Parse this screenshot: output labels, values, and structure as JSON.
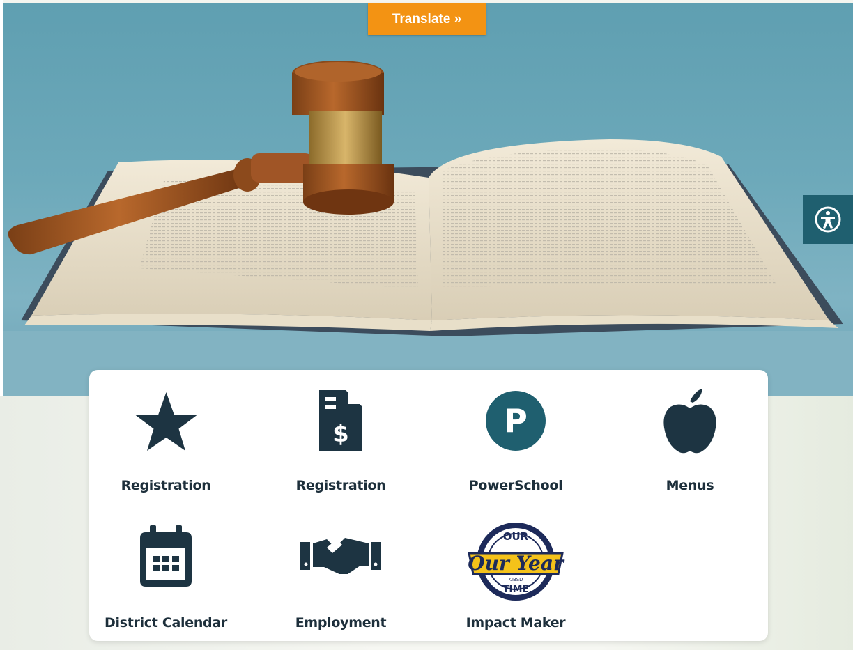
{
  "translate": {
    "label": "Translate »"
  },
  "accessibility": {
    "icon": "accessibility-icon"
  },
  "colors": {
    "navy": "#1d3442",
    "teal": "#1f5f6f",
    "orange": "#f39313"
  },
  "quick_links": [
    {
      "label": "Registration",
      "icon": "star-icon"
    },
    {
      "label": "Registration",
      "icon": "invoice-icon"
    },
    {
      "label": "PowerSchool",
      "icon": "powerschool-icon"
    },
    {
      "label": "Menus",
      "icon": "apple-icon"
    },
    {
      "label": "District Calendar",
      "icon": "calendar-icon"
    },
    {
      "label": "Employment",
      "icon": "handshake-icon"
    },
    {
      "label": "Impact Maker",
      "icon": "our-year-logo",
      "logo_text": [
        "OUR",
        "Our Year",
        "KIBSD",
        "TIME"
      ]
    }
  ]
}
